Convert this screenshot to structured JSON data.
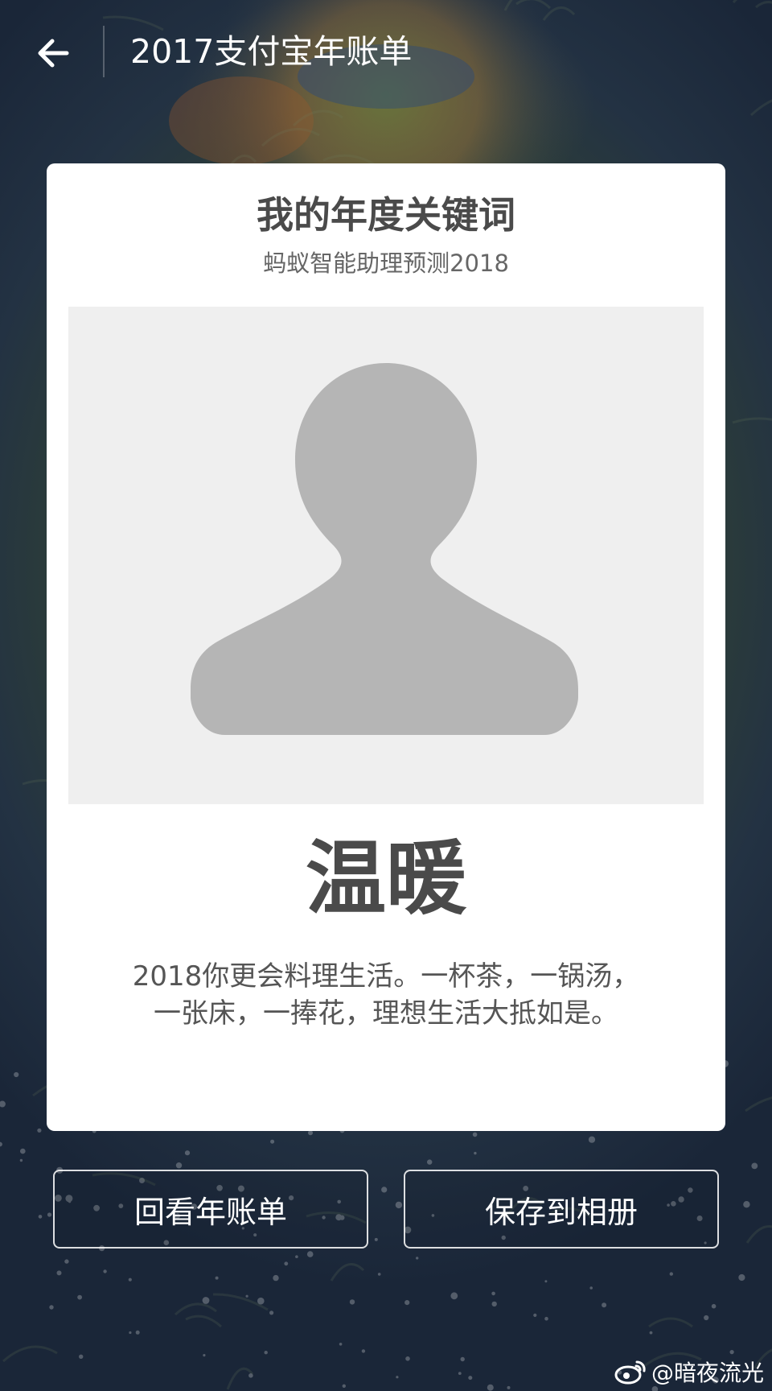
{
  "header": {
    "title": "2017支付宝年账单",
    "back_icon": "arrow-left-icon"
  },
  "card": {
    "title": "我的年度关键词",
    "subtitle": "蚂蚁智能助理预测2018",
    "image_placeholder_icon": "person-silhouette-icon",
    "keyword": "温暖",
    "description": "2018你更会料理生活。一杯茶，一锅汤，一张床，一捧花，理想生活大抵如是。"
  },
  "actions": {
    "review_label": "回看年账单",
    "save_label": "保存到相册"
  },
  "watermark": {
    "text": "@暗夜流光",
    "icon": "weibo-icon"
  },
  "colors": {
    "card_bg": "#ffffff",
    "text_dark": "#4a4a4a",
    "placeholder_bg": "#efefef",
    "silhouette": "#b5b5b5"
  }
}
